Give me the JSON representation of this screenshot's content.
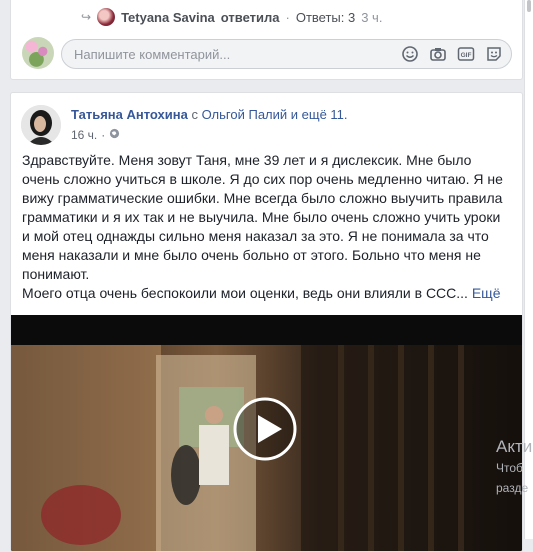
{
  "previous_post": {
    "reply_row": {
      "author": "Tetyana Savina",
      "action": "ответила",
      "separator": "·",
      "replies": "Ответы: 3",
      "time": "3 ч."
    },
    "comment_box": {
      "placeholder": "Напишите комментарий...",
      "icons": [
        "emoji-icon",
        "camera-icon",
        "gif-icon",
        "sticker-icon"
      ]
    }
  },
  "post": {
    "author": "Татьяна Антохина",
    "with_word": "с",
    "tagged": "Ольгой Палий и ещё 11.",
    "time": "16 ч.",
    "dot": "·",
    "privacy_icon": "globe-icon",
    "text": "Здравствуйте. Меня зовут Таня, мне 39 лет и я дислексик. Мне было очень сложно учиться в школе. Я до сих пор очень медленно читаю. Я не вижу грамматические ошибки. Мне всегда было сложно выучить правила грамматики и я их так и не выучила. Мне было очень сложно учить уроки и мой отец однажды сильно меня наказал за это. Я не понимала за что меня наказали и мне было очень больно от этого. Больно что меня не понимают.",
    "text2": "Моего отца очень беспокоили мои оценки, ведь они влияли в ССС...",
    "more": "Ещё",
    "video": {
      "play_icon": "play-icon"
    }
  },
  "overlay": {
    "line1": "Акти",
    "line2": "Чтоб",
    "line3": "разде"
  },
  "colors": {
    "link": "#365899",
    "page_bg": "#e9ebee",
    "muted": "#90949c"
  }
}
